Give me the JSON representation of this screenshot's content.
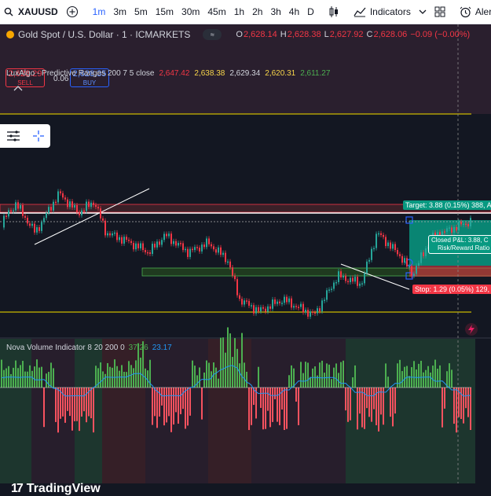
{
  "toolbar": {
    "symbol": "XAUUSD",
    "timeframes": [
      {
        "label": "1m",
        "active": true
      },
      {
        "label": "3m",
        "active": false
      },
      {
        "label": "5m",
        "active": false
      },
      {
        "label": "15m",
        "active": false
      },
      {
        "label": "30m",
        "active": false
      },
      {
        "label": "45m",
        "active": false
      },
      {
        "label": "1h",
        "active": false
      },
      {
        "label": "2h",
        "active": false
      },
      {
        "label": "3h",
        "active": false
      },
      {
        "label": "4h",
        "active": false
      },
      {
        "label": "D",
        "active": false
      }
    ],
    "indicators_label": "Indicators",
    "alert_label": "Alert"
  },
  "legend": {
    "title": "Gold Spot / U.S. Dollar · 1 · ICMARKETS",
    "o_label": "O",
    "o": "2,628.14",
    "h_label": "H",
    "h": "2,628.38",
    "l_label": "L",
    "l": "2,627.92",
    "c_label": "C",
    "c": "2,628.06",
    "change": "−0.09 (−0.00%)"
  },
  "trade": {
    "sell_price": "2,628.29",
    "sell_label": "SELL",
    "spread": "0.06",
    "buy_price": "2,628.35",
    "buy_label": "BUY"
  },
  "luxalgo": {
    "name": "LuxAlgo - Predictive Ranges 200 7 5 close",
    "v1": "2,647.42",
    "v2": "2,638.38",
    "v3": "2,629.34",
    "v4": "2,620.31",
    "v5": "2,611.27"
  },
  "labels": {
    "target": "Target: 3.88 (0.15%) 388, A",
    "closed_pl": "Closed P&L: 3.88, C",
    "risk_reward": "Risk/Reward Ratio",
    "stop": "Stop: 1.29 (0.05%) 129,"
  },
  "nova": {
    "name": "Nova Volume Indicator 8 20 200 0",
    "v1": "37.26",
    "v2": "23.17"
  },
  "brand": "TradingView",
  "colors": {
    "bull": "#26a69a",
    "bear": "#f23645",
    "accent": "#2962ff",
    "level_yellow": "#c9b800",
    "target_green": "#089981",
    "stop_red": "#f23645"
  },
  "icons": [
    "search-icon",
    "add-symbol-icon",
    "candles-icon",
    "indicators-icon",
    "chevron-down-icon",
    "layout-icon",
    "alert-icon",
    "menu-icon",
    "crosshair-icon",
    "bolt-icon"
  ]
}
